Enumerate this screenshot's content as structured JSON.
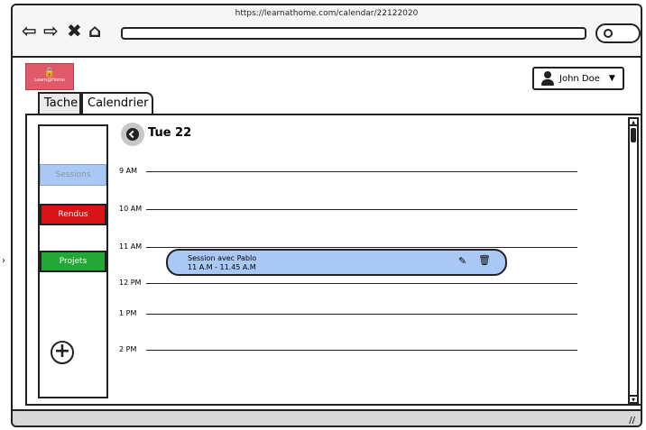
{
  "browser": {
    "url": "https://learnathome.com/calendar/22122020",
    "back_icon": "⇦",
    "forward_icon": "⇨",
    "close_icon": "✖",
    "home_icon": "⌂"
  },
  "header": {
    "logo_text": "Learn@Home",
    "user_name": "John Doe",
    "dropdown_icon": "▼"
  },
  "tabs": [
    {
      "label": "Tache"
    },
    {
      "label": "Calendrier"
    }
  ],
  "sidebar": {
    "items": [
      {
        "label": "Sessions"
      },
      {
        "label": "Rendus"
      },
      {
        "label": "Projets"
      }
    ],
    "add_icon": "+"
  },
  "calendar": {
    "day": "Tue 22",
    "hours": [
      "9 AM",
      "10 AM",
      "11 AM",
      "12 PM",
      "1 PM",
      "2 PM"
    ]
  },
  "event": {
    "title": "Session avec Pablo",
    "time": "11 A.M - 11.45 A.M",
    "edit_icon": "✎",
    "delete_icon": "🗑"
  },
  "colors": {
    "sessions": "#aac8f5",
    "rendus": "#d81419",
    "projets": "#24a734",
    "event": "#aac8f5",
    "logo": "#e05a6a"
  }
}
